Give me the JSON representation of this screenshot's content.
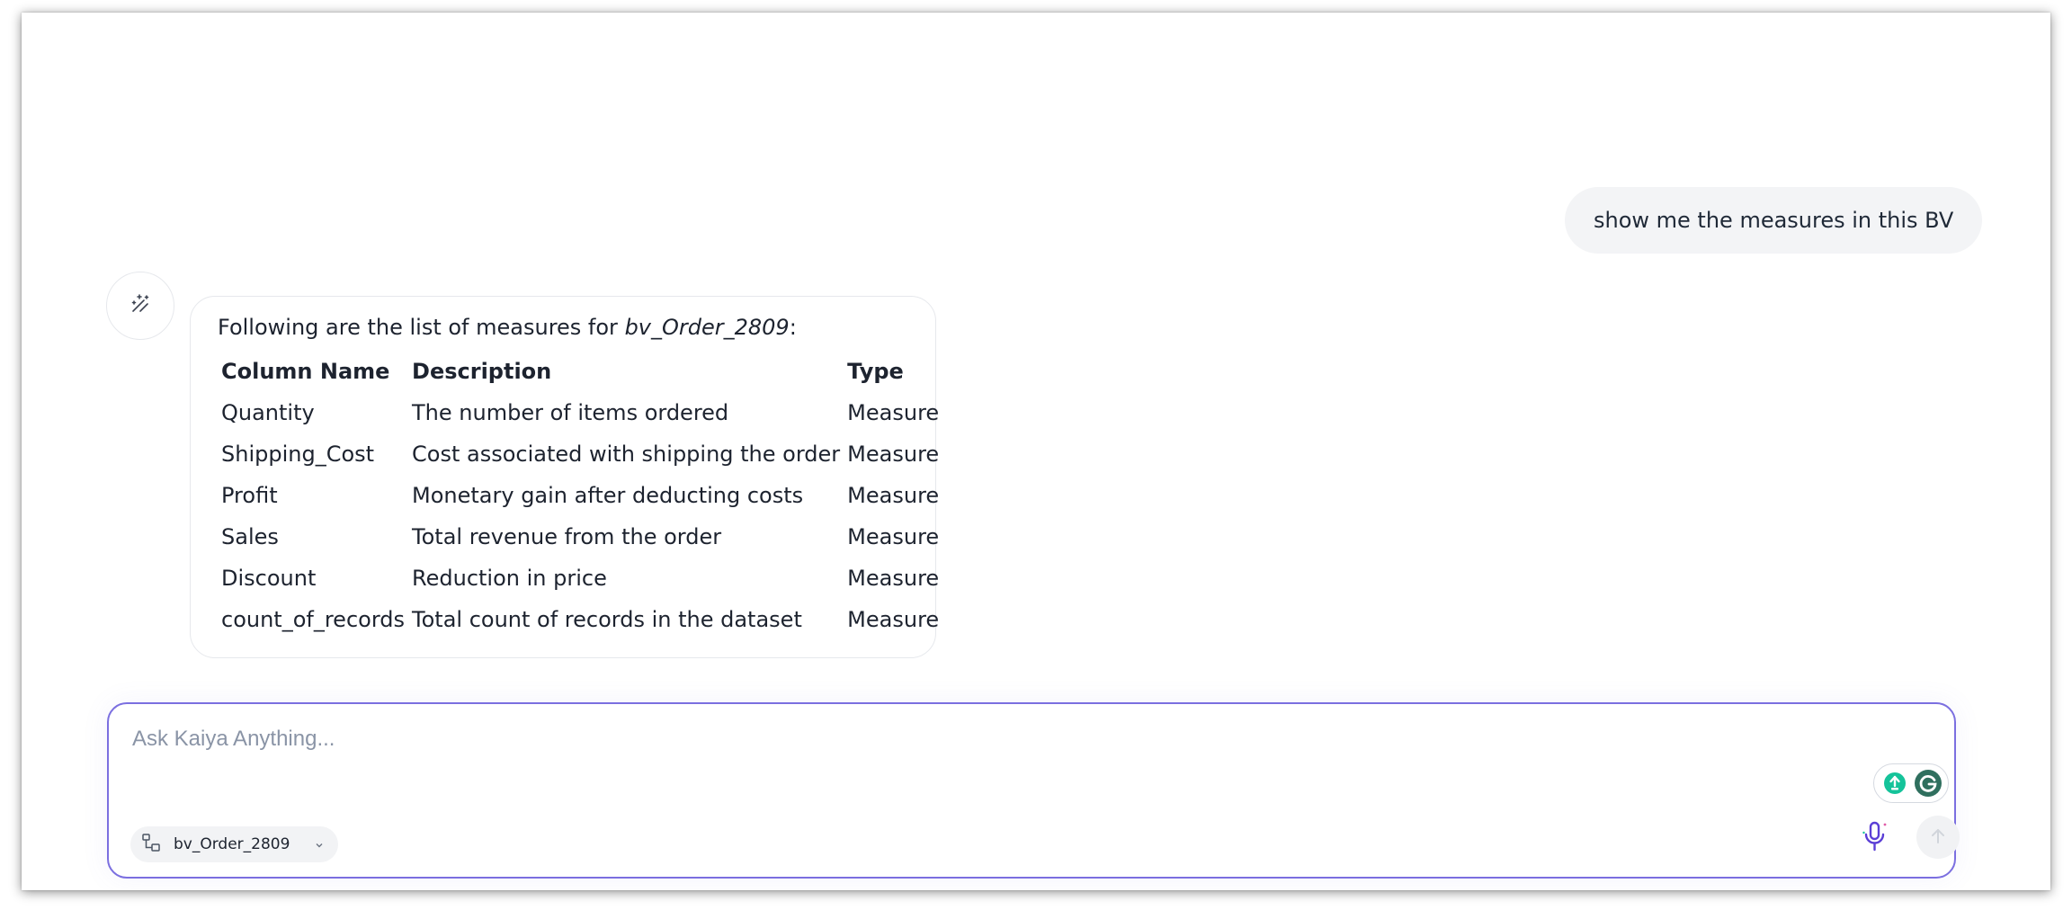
{
  "chat": {
    "user_message": "show me the measures in this BV",
    "assistant": {
      "avatar_icon": "magic-wand-icon",
      "intro_prefix": "Following are the list of measures for ",
      "intro_dataset": "bv_Order_2809",
      "intro_suffix": ":",
      "table": {
        "headers": [
          "Column Name",
          "Description",
          "Type"
        ],
        "rows": [
          [
            "Quantity",
            "The number of items ordered",
            "Measure"
          ],
          [
            "Shipping_Cost",
            "Cost associated with shipping the order",
            "Measure"
          ],
          [
            "Profit",
            "Monetary gain after deducting costs",
            "Measure"
          ],
          [
            "Sales",
            "Total revenue from the order",
            "Measure"
          ],
          [
            "Discount",
            "Reduction in price",
            "Measure"
          ],
          [
            "count_of_records",
            "Total count of records in the dataset",
            "Measure"
          ]
        ]
      }
    }
  },
  "composer": {
    "placeholder": "Ask Kaiya Anything...",
    "value": "",
    "source_chip": {
      "label": "bv_Order_2809",
      "icon": "data-model-icon",
      "dropdown_icon": "caret-down-icon"
    },
    "mic_icon": "microphone-icon",
    "send_icon": "arrow-up-icon",
    "grammarly_icons": [
      "lightbulb-icon",
      "grammarly-icon"
    ]
  },
  "colors": {
    "accent_border": "#7b6fe0",
    "mic_purple": "#5b3fd6",
    "grammarly_green": "#15c39a",
    "grammarly_dark": "#2f6f5e"
  }
}
